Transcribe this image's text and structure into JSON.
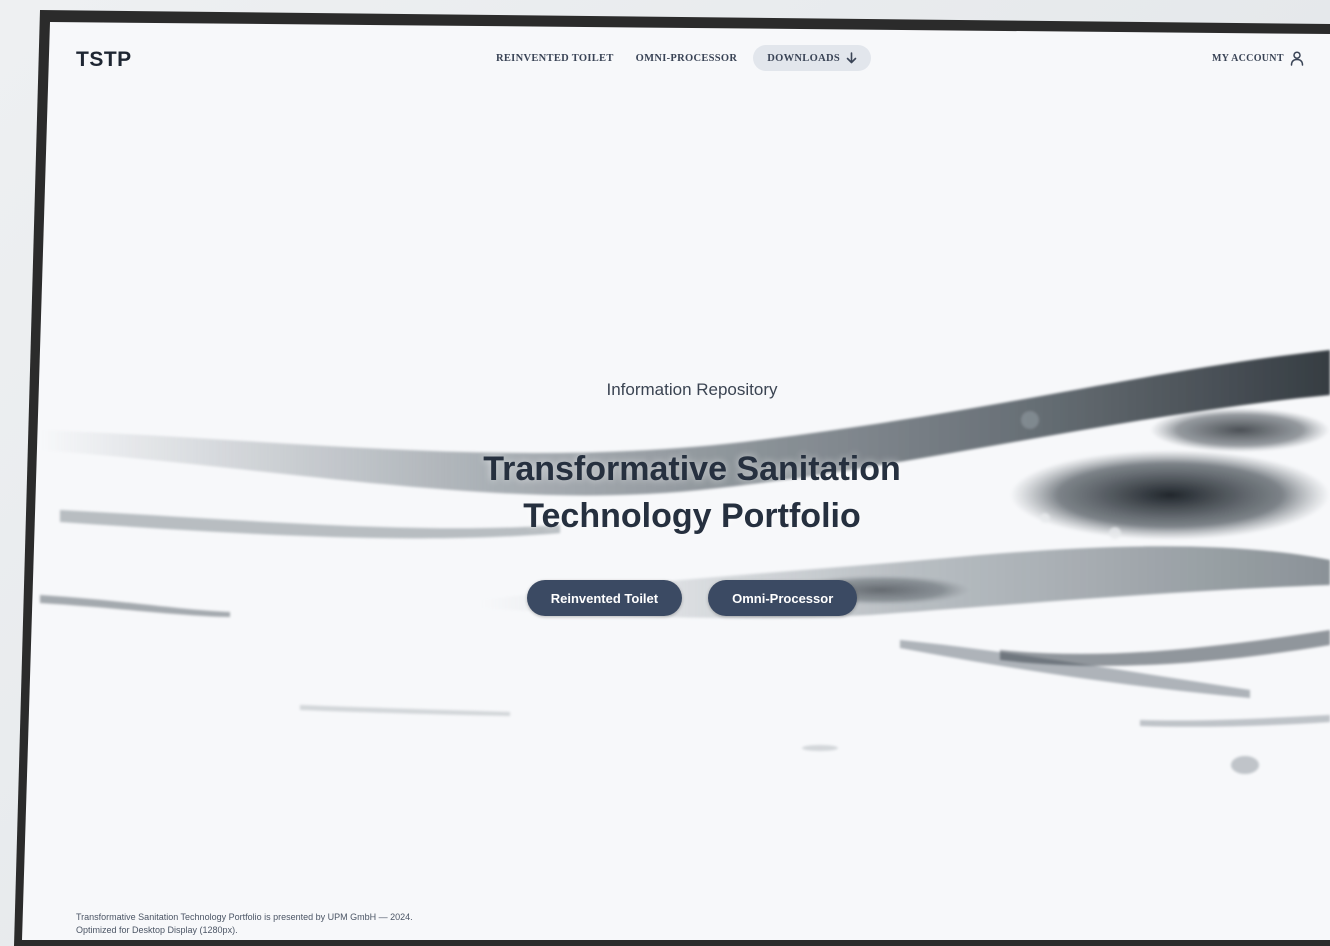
{
  "brand": {
    "logo": "TSTP"
  },
  "nav": {
    "items": [
      {
        "label": "REINVENTED TOILET"
      },
      {
        "label": "OMNI-PROCESSOR"
      },
      {
        "label": "DOWNLOADS",
        "icon": "arrow-down-icon",
        "active": true
      }
    ],
    "account": {
      "label": "MY ACCOUNT",
      "icon": "user-icon"
    }
  },
  "hero": {
    "eyebrow": "Information Repository",
    "title_line1": "Transformative Sanitation",
    "title_line2": "Technology Portfolio",
    "buttons": [
      {
        "label": "Reinvented Toilet"
      },
      {
        "label": "Omni-Processor"
      }
    ]
  },
  "footer": {
    "line1": "Transformative Sanitation Technology Portfolio is presented by UPM GmbH — 2024.",
    "line2": "Optimized for Desktop Display (1280px)."
  },
  "colors": {
    "button_bg": "#3b4a63",
    "heading": "#26303f",
    "page_bg": "#f7f8fa"
  }
}
